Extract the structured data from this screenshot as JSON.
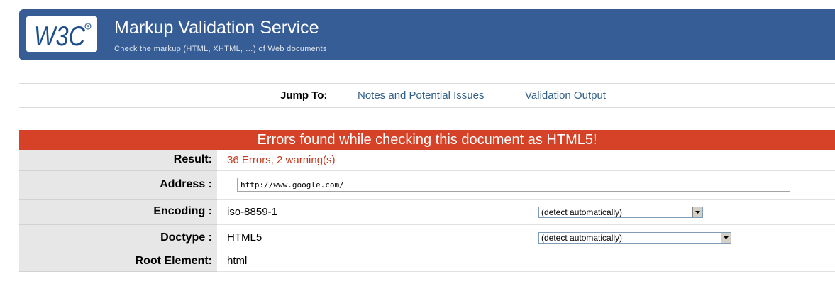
{
  "header": {
    "logo_text": "W3C",
    "title": "Markup Validation Service",
    "subtitle": "Check the markup (HTML, XHTML, …) of Web documents"
  },
  "jump": {
    "label": "Jump To:",
    "links": [
      "Notes and Potential Issues",
      "Validation Output"
    ]
  },
  "error_banner": "Errors found while checking this document as HTML5!",
  "results": {
    "result": {
      "label": "Result:",
      "value": "36 Errors, 2 warning(s)"
    },
    "address": {
      "label": "Address :",
      "value": "http://www.google.com/"
    },
    "encoding": {
      "label": "Encoding :",
      "value": "iso-8859-1",
      "select": "(detect automatically)"
    },
    "doctype": {
      "label": "Doctype :",
      "value": "HTML5",
      "select": "(detect automatically)"
    },
    "root": {
      "label": "Root Element:",
      "value": "html"
    }
  },
  "colors": {
    "banner": "#365d95",
    "error": "#d64227",
    "link": "#315f87"
  }
}
